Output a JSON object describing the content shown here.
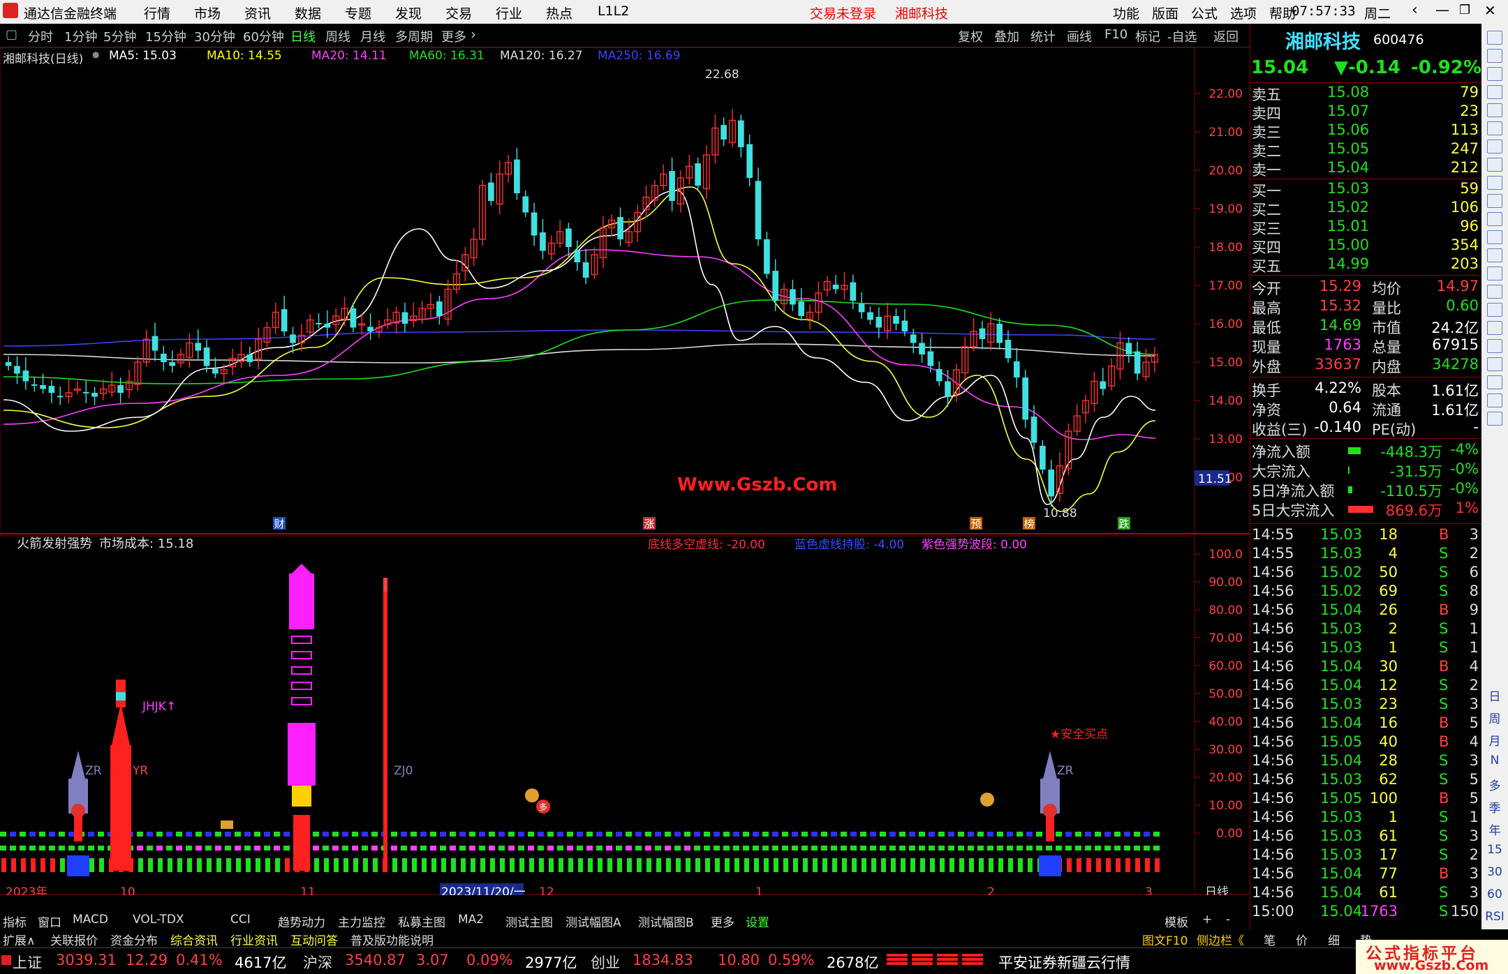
{
  "title": {
    "app_name": "通达信金融终端",
    "menu": [
      "行情",
      "市场",
      "资讯",
      "数据",
      "专题",
      "发现",
      "交易",
      "行业",
      "热点",
      "L1L2"
    ],
    "center": [
      "交易未登录",
      "湘邮科技"
    ],
    "right_menu": [
      "功能",
      "版面",
      "公式",
      "选项",
      "帮助"
    ],
    "time": "07:57:33",
    "weekday": "周二"
  },
  "periods": [
    "分时",
    "1分钟",
    "5分钟",
    "15分钟",
    "30分钟",
    "60分钟",
    "日线",
    "周线",
    "月线",
    "多周期",
    "更多"
  ],
  "active_period": "日线",
  "tools": [
    "复权",
    "叠加",
    "统计",
    "画线",
    "F10",
    "标记",
    "-自选",
    "返回"
  ],
  "main_chart": {
    "label": "湘邮科技(日线)",
    "ma": [
      {
        "text": "MA5: 15.03",
        "color": "#ffffff"
      },
      {
        "text": "MA10: 14.55",
        "color": "#ffff00"
      },
      {
        "text": "MA20: 14.11",
        "color": "#ff40ff"
      },
      {
        "text": "MA60: 16.31",
        "color": "#20e020"
      },
      {
        "text": "MA120: 16.27",
        "color": "#dddddd"
      },
      {
        "text": "MA250: 16.69",
        "color": "#4040ff"
      }
    ],
    "y_ticks": [
      "22.00",
      "21.00",
      "20.00",
      "19.00",
      "18.00",
      "17.00",
      "16.00",
      "15.00",
      "14.00",
      "13.00",
      "12.00"
    ],
    "high_label": "22.68",
    "low_label": "10.88",
    "price_tag": "11.51",
    "watermark": "Www.Gszb.Com",
    "markers": [
      "财",
      "涨",
      "预",
      "榜",
      "跌"
    ]
  },
  "indicator": {
    "name": "火箭发射强势",
    "cost": "市场成本: 15.18",
    "lines": [
      {
        "text": "底线多空虚线: -20.00",
        "color": "#ff3030"
      },
      {
        "text": "蓝色虚线持股: -4.00",
        "color": "#3050ff"
      },
      {
        "text": "紫色强势波段: 0.00",
        "color": "#ff40ff"
      }
    ],
    "y_ticks": [
      "100.0",
      "90.00",
      "80.00",
      "70.00",
      "60.00",
      "50.00",
      "40.00",
      "30.00",
      "20.00",
      "10.00",
      "0.00"
    ],
    "labels": [
      "ZR",
      "YR",
      "JHJK↑",
      "ZJ0",
      "ZR",
      "★安全买点"
    ],
    "bag_glyph": "多"
  },
  "x_axis": [
    "2023年",
    "10",
    "11",
    "2023/11/20/一",
    "12",
    "1",
    "2",
    "3"
  ],
  "x_axis_right": "日线",
  "stock": {
    "name": "湘邮科技",
    "code": "600476",
    "price": "15.04",
    "change": "▼-0.14",
    "pct": "-0.92%"
  },
  "asks": [
    {
      "label": "卖五",
      "price": "15.08",
      "vol": "79"
    },
    {
      "label": "卖四",
      "price": "15.07",
      "vol": "23"
    },
    {
      "label": "卖三",
      "price": "15.06",
      "vol": "113"
    },
    {
      "label": "卖二",
      "price": "15.05",
      "vol": "247"
    },
    {
      "label": "卖一",
      "price": "15.04",
      "vol": "212"
    }
  ],
  "bids": [
    {
      "label": "买一",
      "price": "15.03",
      "vol": "59"
    },
    {
      "label": "买二",
      "price": "15.02",
      "vol": "106"
    },
    {
      "label": "买三",
      "price": "15.01",
      "vol": "96"
    },
    {
      "label": "买四",
      "price": "15.00",
      "vol": "354"
    },
    {
      "label": "买五",
      "price": "14.99",
      "vol": "203"
    }
  ],
  "quote": [
    [
      "今开",
      "15.29",
      "均价",
      "14.97"
    ],
    [
      "最高",
      "15.32",
      "量比",
      "0.60"
    ],
    [
      "最低",
      "14.69",
      "市值",
      "24.2亿"
    ],
    [
      "现量",
      "1763",
      "总量",
      "67915"
    ],
    [
      "外盘",
      "33637",
      "内盘",
      "34278"
    ],
    [
      "换手",
      "4.22%",
      "股本",
      "1.61亿"
    ],
    [
      "净资",
      "0.64",
      "流通",
      "1.61亿"
    ],
    [
      "收益(三)",
      "-0.140",
      "PE(动)",
      "-"
    ]
  ],
  "flows": [
    {
      "label": "净流入额",
      "value": "-448.3万",
      "pct": "-4%"
    },
    {
      "label": "大宗流入",
      "value": "-31.5万",
      "pct": "-0%"
    },
    {
      "label": "5日净流入额",
      "value": "-110.5万",
      "pct": "-0%"
    },
    {
      "label": "5日大宗流入",
      "value": "869.6万",
      "pct": "1%"
    }
  ],
  "ticks": [
    [
      "14:55",
      "15.03",
      "18",
      "B",
      "3"
    ],
    [
      "14:55",
      "15.03",
      "4",
      "S",
      "2"
    ],
    [
      "14:56",
      "15.02",
      "50",
      "S",
      "6"
    ],
    [
      "14:56",
      "15.02",
      "69",
      "S",
      "8"
    ],
    [
      "14:56",
      "15.04",
      "26",
      "B",
      "9"
    ],
    [
      "14:56",
      "15.03",
      "2",
      "S",
      "1"
    ],
    [
      "14:56",
      "15.03",
      "1",
      "S",
      "1"
    ],
    [
      "14:56",
      "15.04",
      "30",
      "B",
      "4"
    ],
    [
      "14:56",
      "15.04",
      "12",
      "S",
      "2"
    ],
    [
      "14:56",
      "15.03",
      "23",
      "S",
      "3"
    ],
    [
      "14:56",
      "15.04",
      "16",
      "B",
      "5"
    ],
    [
      "14:56",
      "15.05",
      "40",
      "B",
      "4"
    ],
    [
      "14:56",
      "15.04",
      "28",
      "S",
      "3"
    ],
    [
      "14:56",
      "15.03",
      "62",
      "S",
      "5"
    ],
    [
      "14:56",
      "15.05",
      "100",
      "B",
      "5"
    ],
    [
      "14:56",
      "15.03",
      "1",
      "S",
      "1"
    ],
    [
      "14:56",
      "15.03",
      "61",
      "S",
      "3"
    ],
    [
      "14:56",
      "15.03",
      "17",
      "S",
      "2"
    ],
    [
      "14:56",
      "15.04",
      "77",
      "B",
      "3"
    ],
    [
      "14:56",
      "15.04",
      "61",
      "S",
      "3"
    ],
    [
      "15:00",
      "15.04",
      "1763",
      "S",
      "150"
    ]
  ],
  "side_icons": [
    "日",
    "周",
    "月",
    "N",
    "多",
    "季",
    "年",
    "15",
    "30",
    "60",
    "RSI"
  ],
  "tabs1": [
    "指标",
    "窗口",
    "MACD",
    "VOL-TDX",
    "CCI",
    "趋势动力",
    "主力监控",
    "私募主图",
    "MA2",
    "测试主图",
    "测试幅图A",
    "测试幅图B",
    "更多",
    "设置"
  ],
  "tabs1_right": [
    "模板",
    "+",
    "-"
  ],
  "tabs2": [
    "扩展∧",
    "关联报价",
    "资金分布",
    "综合资讯",
    "行业资讯",
    "互动问答",
    "普及版功能说明"
  ],
  "tabs2_right": [
    "图文F10",
    "侧边栏《",
    "笔",
    "价",
    "细",
    "势"
  ],
  "status": {
    "indices": [
      {
        "name": "上证",
        "value": "3039.31",
        "chg": "12.29",
        "pct": "0.41%",
        "amt": "4617亿"
      },
      {
        "name": "沪深",
        "value": "3540.87",
        "chg": "3.07",
        "pct": "0.09%",
        "amt": "2977亿"
      },
      {
        "name": "创业",
        "value": "1834.83",
        "chg": "10.80",
        "pct": "0.59%",
        "amt": "2678亿"
      }
    ],
    "server": "平安证券新疆云行情",
    "brand": "公式指标平台",
    "brand_url": "www.Gszb.Com"
  }
}
